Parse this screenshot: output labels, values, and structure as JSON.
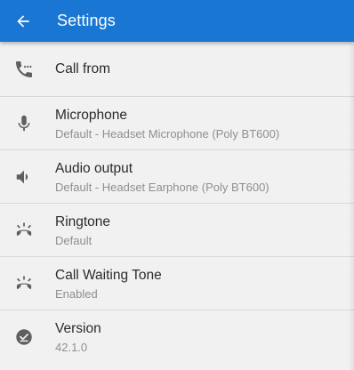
{
  "header": {
    "title": "Settings"
  },
  "settings": {
    "items": [
      {
        "title": "Call from",
        "subtitle": "",
        "icon": "phone-forward-icon"
      },
      {
        "title": "Microphone",
        "subtitle": "Default - Headset Microphone (Poly BT600)",
        "icon": "microphone-icon"
      },
      {
        "title": "Audio output",
        "subtitle": "Default - Headset Earphone (Poly BT600)",
        "icon": "speaker-icon"
      },
      {
        "title": "Ringtone",
        "subtitle": "Default",
        "icon": "ringing-phone-icon"
      },
      {
        "title": "Call Waiting Tone",
        "subtitle": "Enabled",
        "icon": "ringing-phone-icon"
      },
      {
        "title": "Version",
        "subtitle": "42.1.0",
        "icon": "check-circle-icon"
      }
    ]
  },
  "colors": {
    "toolbar": "#1976d2",
    "background": "#f1f1f1",
    "icon": "#5f5f5f"
  }
}
